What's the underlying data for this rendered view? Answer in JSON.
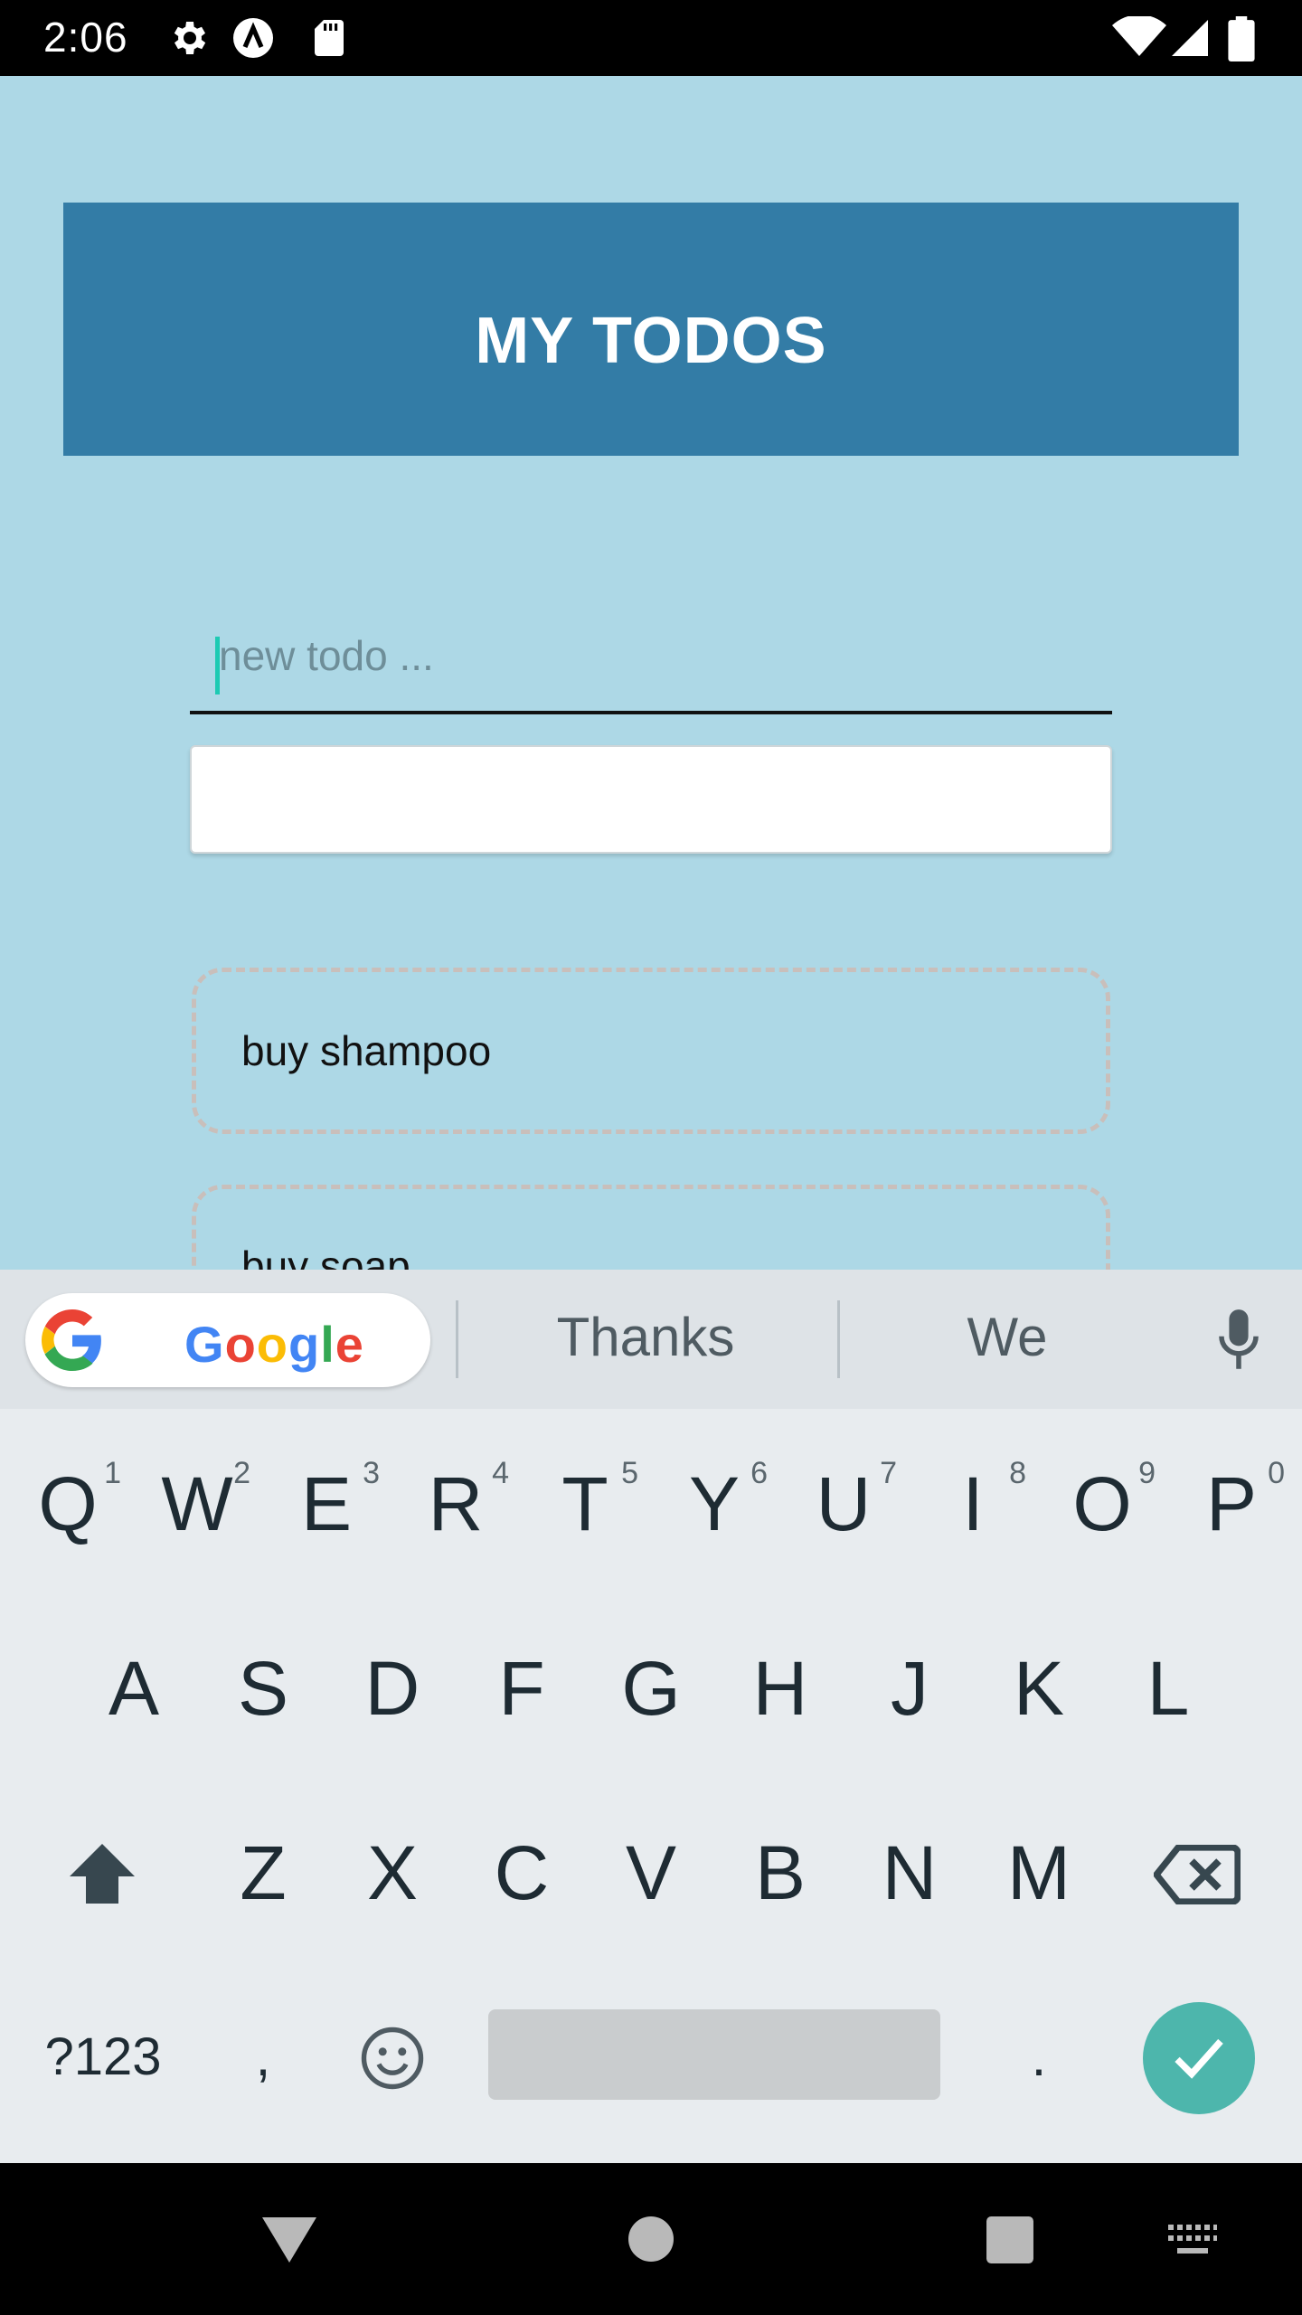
{
  "status_bar": {
    "time": "2:06",
    "left_icons": [
      "gear-icon",
      "a-circle-icon",
      "sd-card-icon"
    ],
    "right_icons": [
      "wifi-icon",
      "signal-icon",
      "battery-icon"
    ]
  },
  "app": {
    "title": "MY TODOS",
    "input_placeholder": "new todo ...",
    "input_value": "",
    "add_button_label": "",
    "todos": [
      "buy shampoo",
      "buy soap"
    ],
    "colors": {
      "background": "#add8e6",
      "header": "#337ca6",
      "caret": "#1ecab3"
    }
  },
  "keyboard": {
    "google_word": "Google",
    "suggestions": [
      "Thanks",
      "We"
    ],
    "row1": [
      {
        "key": "Q",
        "hint": "1"
      },
      {
        "key": "W",
        "hint": "2"
      },
      {
        "key": "E",
        "hint": "3"
      },
      {
        "key": "R",
        "hint": "4"
      },
      {
        "key": "T",
        "hint": "5"
      },
      {
        "key": "Y",
        "hint": "6"
      },
      {
        "key": "U",
        "hint": "7"
      },
      {
        "key": "I",
        "hint": "8"
      },
      {
        "key": "O",
        "hint": "9"
      },
      {
        "key": "P",
        "hint": "0"
      }
    ],
    "row2": [
      "A",
      "S",
      "D",
      "F",
      "G",
      "H",
      "J",
      "K",
      "L"
    ],
    "row3": [
      "Z",
      "X",
      "C",
      "V",
      "B",
      "N",
      "M"
    ],
    "symbols_label": "?123",
    "comma": ",",
    "period": ".",
    "enter_color": "#4db6ac"
  },
  "nav_bar": {
    "icons": [
      "back-triangle-icon",
      "home-circle-icon",
      "recents-square-icon",
      "keyboard-switch-icon"
    ]
  }
}
